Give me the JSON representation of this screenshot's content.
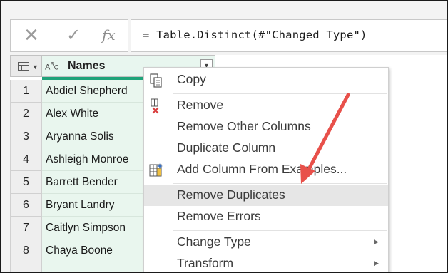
{
  "formula_bar": {
    "cancel_icon": "close-icon",
    "commit_icon": "check-icon",
    "fx_label": "fx",
    "formula": "= Table.Distinct(#\"Changed Type\")"
  },
  "grid": {
    "column": {
      "type_label": "ABC",
      "name": "Names"
    },
    "rows": [
      {
        "num": "1",
        "name": "Abdiel Shepherd"
      },
      {
        "num": "2",
        "name": "Alex White"
      },
      {
        "num": "3",
        "name": "Aryanna Solis"
      },
      {
        "num": "4",
        "name": "Ashleigh Monroe"
      },
      {
        "num": "5",
        "name": "Barrett Bender"
      },
      {
        "num": "6",
        "name": "Bryant Landry"
      },
      {
        "num": "7",
        "name": "Caitlyn Simpson"
      },
      {
        "num": "8",
        "name": "Chaya Boone"
      }
    ]
  },
  "context_menu": {
    "items": [
      {
        "label": "Copy",
        "icon": "copy-icon"
      },
      {
        "label": "Remove",
        "icon": "remove-column-icon"
      },
      {
        "label": "Remove Other Columns"
      },
      {
        "label": "Duplicate Column"
      },
      {
        "label": "Add Column From Examples...",
        "icon": "add-column-from-examples-icon"
      },
      {
        "label": "Remove Duplicates",
        "highlighted": true
      },
      {
        "label": "Remove Errors"
      },
      {
        "label": "Change Type",
        "submenu": true
      },
      {
        "label": "Transform",
        "submenu": true
      }
    ]
  },
  "colors": {
    "column_accent": "#1fa37a",
    "column_fill": "#e9f6ee",
    "annotation_arrow": "#e8504a",
    "highlight": "#e6e6e6"
  }
}
